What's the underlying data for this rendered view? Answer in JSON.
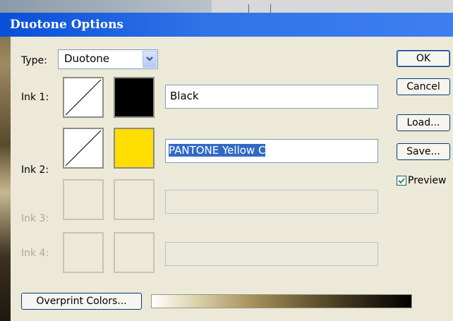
{
  "window": {
    "title": "Duotone Options"
  },
  "type_select": {
    "label": "Type:",
    "value": "Duotone"
  },
  "inks": [
    {
      "label": "Ink 1:",
      "name": "Black",
      "color": "#000000",
      "enabled": true,
      "selected": false
    },
    {
      "label": "Ink 2:",
      "name": "PANTONE Yellow C",
      "color": "#fedd00",
      "enabled": true,
      "selected": true
    },
    {
      "label": "Ink 3:",
      "name": "",
      "enabled": false
    },
    {
      "label": "Ink 4:",
      "name": "",
      "enabled": false
    }
  ],
  "buttons": {
    "ok": "OK",
    "cancel": "Cancel",
    "load": "Load...",
    "save": "Save...",
    "overprint": "Overprint Colors..."
  },
  "preview": {
    "label": "Preview",
    "checked": true
  },
  "colors": {
    "title_bar": "#2f73e8",
    "selection": "#316ac5",
    "dialog_bg": "#ece9d8"
  }
}
